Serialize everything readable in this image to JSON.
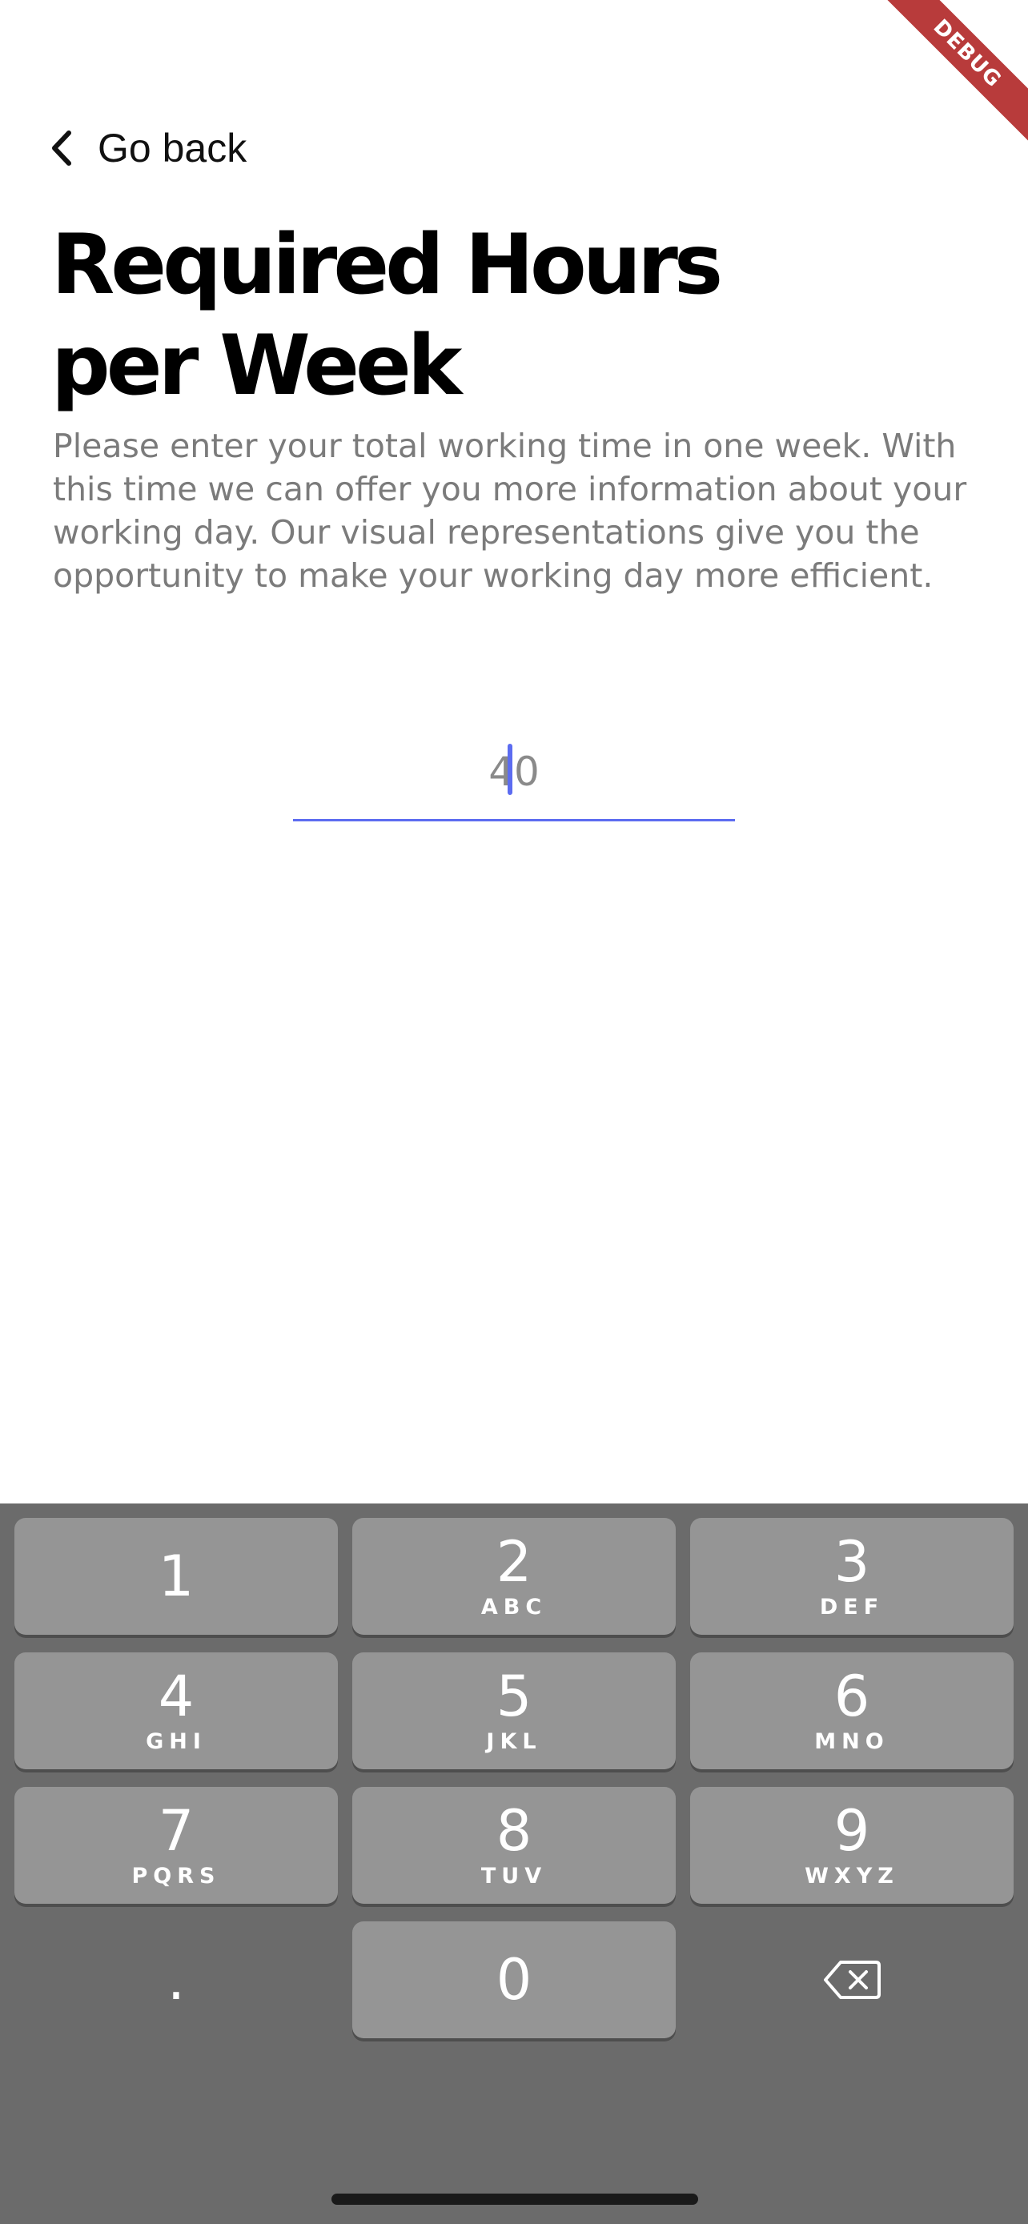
{
  "debug_banner": "DEBUG",
  "header": {
    "back_label": "Go back",
    "title_line1": "Required Hours",
    "title_line2": "per Week",
    "description": "Please enter your total working time in one week. With this time we can offer you more information about your working day. Our visual representations give you the opportunity to make your working day more efficient."
  },
  "input": {
    "value": "40"
  },
  "keyboard": {
    "keys": [
      {
        "digit": "1",
        "letters": ""
      },
      {
        "digit": "2",
        "letters": "ABC"
      },
      {
        "digit": "3",
        "letters": "DEF"
      },
      {
        "digit": "4",
        "letters": "GHI"
      },
      {
        "digit": "5",
        "letters": "JKL"
      },
      {
        "digit": "6",
        "letters": "MNO"
      },
      {
        "digit": "7",
        "letters": "PQRS"
      },
      {
        "digit": "8",
        "letters": "TUV"
      },
      {
        "digit": "9",
        "letters": "WXYZ"
      },
      {
        "digit": ".",
        "letters": ""
      },
      {
        "digit": "0",
        "letters": ""
      }
    ],
    "delete_icon": "backspace-icon"
  },
  "colors": {
    "accent": "#5c6cf1",
    "debug": "#b83b3b",
    "keyboard_bg": "#6b6b6b",
    "key_bg": "#959595"
  }
}
